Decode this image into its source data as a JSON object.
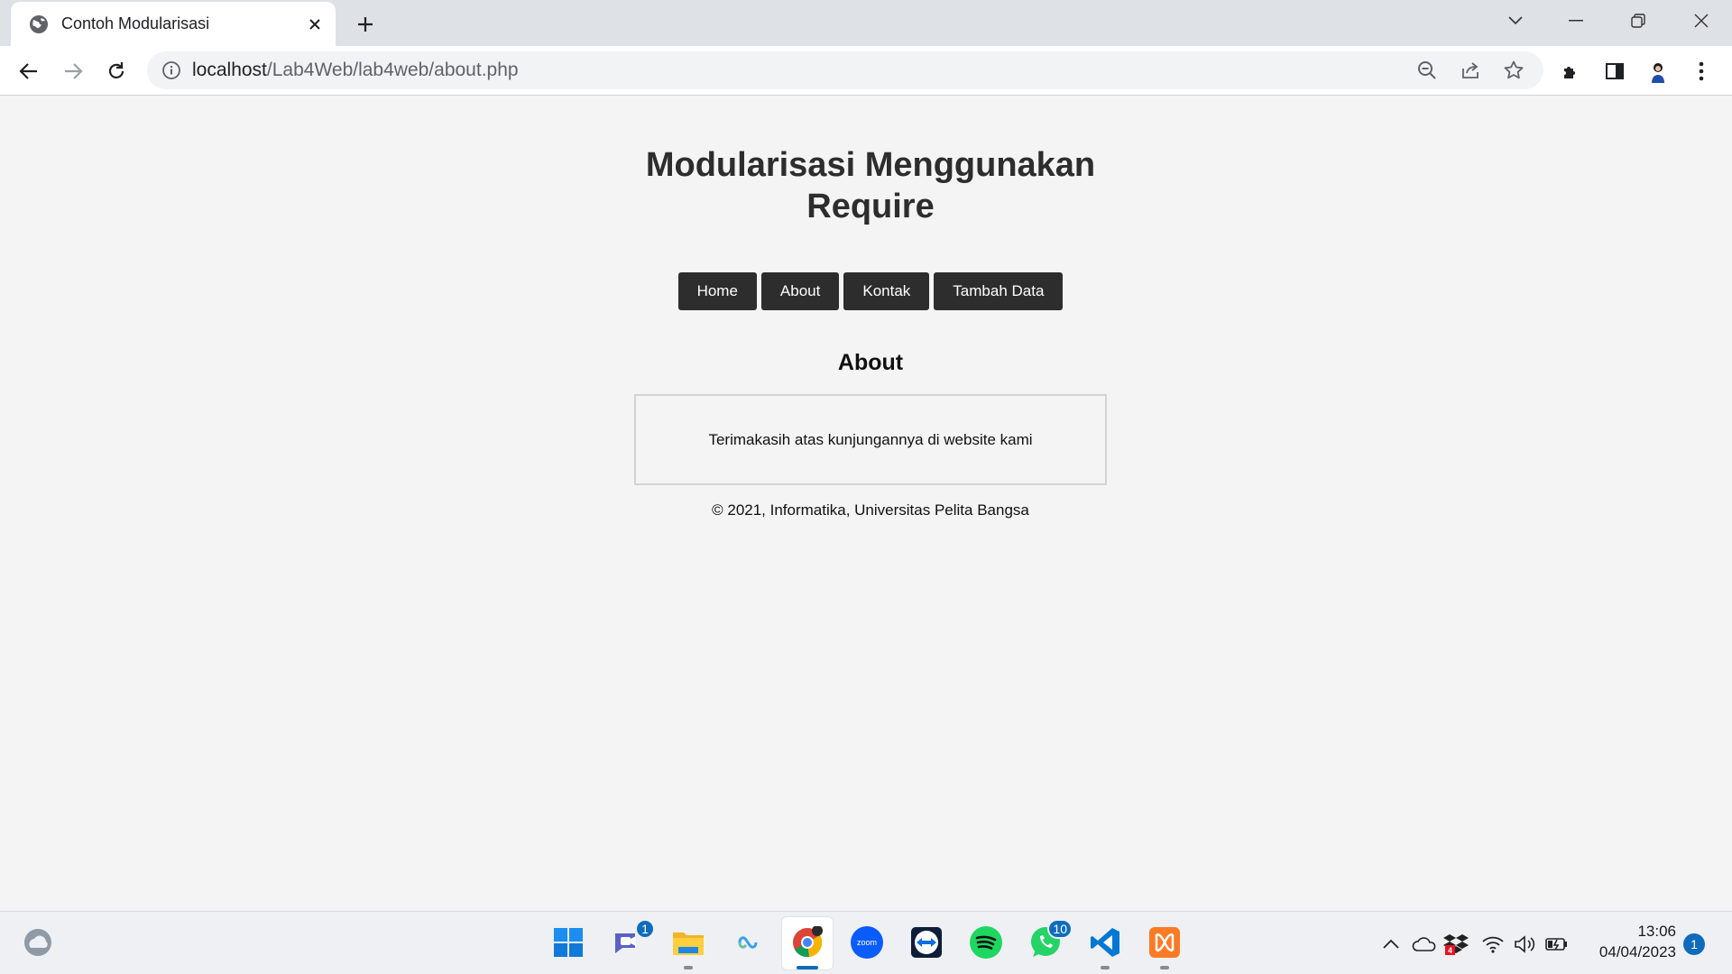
{
  "browser": {
    "tab_title": "Contoh Modularisasi",
    "url_host": "localhost",
    "url_path": "/Lab4Web/lab4web/about.php"
  },
  "page": {
    "site_title": "Modularisasi Menggunakan Require",
    "nav": [
      {
        "label": "Home"
      },
      {
        "label": "About"
      },
      {
        "label": "Kontak"
      },
      {
        "label": "Tambah Data"
      }
    ],
    "section_title": "About",
    "content": "Terimakasih atas kunjungannya di website kami",
    "footer": "© 2021, Informatika, Universitas Pelita Bangsa"
  },
  "taskbar": {
    "apps": [
      {
        "name": "start",
        "icon": "windows-icon"
      },
      {
        "name": "teams",
        "icon": "teams-icon",
        "badge": "1"
      },
      {
        "name": "file-explorer",
        "icon": "folder-icon"
      },
      {
        "name": "copilot",
        "icon": "copilot-icon"
      },
      {
        "name": "chrome",
        "icon": "chrome-icon"
      },
      {
        "name": "zoom",
        "icon": "zoom-icon",
        "label": "zoom"
      },
      {
        "name": "teamviewer",
        "icon": "teamviewer-icon"
      },
      {
        "name": "spotify",
        "icon": "spotify-icon"
      },
      {
        "name": "whatsapp",
        "icon": "whatsapp-icon",
        "badge": "10"
      },
      {
        "name": "vscode",
        "icon": "vscode-icon"
      },
      {
        "name": "xampp",
        "icon": "xampp-icon"
      }
    ],
    "tray_badge": "4",
    "time": "13:06",
    "date": "04/04/2023",
    "notification_count": "1"
  },
  "colors": {
    "nav_bg": "#2d2d2d",
    "page_bg": "#f4f4f4",
    "accent": "#0f6cbd"
  }
}
